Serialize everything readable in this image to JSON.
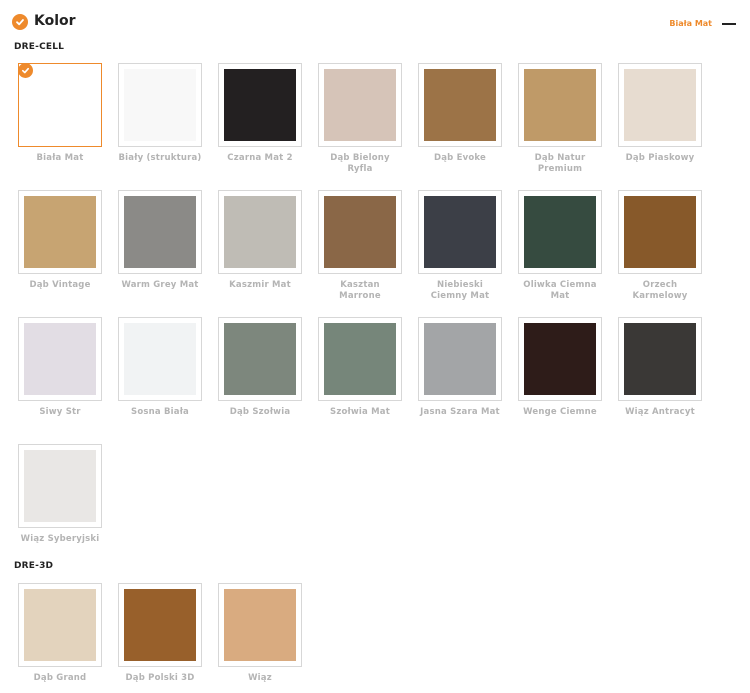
{
  "header": {
    "title": "Kolor",
    "selected_value": "Biała Mat"
  },
  "sections": [
    {
      "title": "DRE-CELL",
      "swatches": [
        {
          "label": "Biała Mat",
          "color": "#ffffff",
          "selected": true
        },
        {
          "label": "Biały (struktura)",
          "color": "#f8f8f8"
        },
        {
          "label": "Czarna Mat 2",
          "color": "#232021"
        },
        {
          "label": "Dąb Bielony Ryfla",
          "color": "#d6c4b8"
        },
        {
          "label": "Dąb Evoke",
          "color": "#9c7347"
        },
        {
          "label": "Dąb Natur Premium",
          "color": "#bf9a68"
        },
        {
          "label": "Dąb Piaskowy",
          "color": "#e7dcd0"
        },
        {
          "label": "Dąb Vintage",
          "color": "#c7a472"
        },
        {
          "label": "Warm Grey Mat",
          "color": "#8b8a87"
        },
        {
          "label": "Kaszmir Mat",
          "color": "#bfbcb5"
        },
        {
          "label": "Kasztan Marrone",
          "color": "#8a6747"
        },
        {
          "label": "Niebieski Ciemny Mat",
          "color": "#3c3f47"
        },
        {
          "label": "Oliwka Ciemna Mat",
          "color": "#364b40"
        },
        {
          "label": "Orzech Karmelowy",
          "color": "#87592a"
        },
        {
          "label": "Siwy Str",
          "color": "#e2dde4"
        },
        {
          "label": "Sosna Biała",
          "color": "#f1f3f4"
        },
        {
          "label": "Dąb Szołwia",
          "color": "#7d877d"
        },
        {
          "label": "Szołwia Mat",
          "color": "#76867a"
        },
        {
          "label": "Jasna Szara Mat",
          "color": "#a3a5a7"
        },
        {
          "label": "Wenge Ciemne",
          "color": "#2e1c19"
        },
        {
          "label": "Wiąz Antracyt",
          "color": "#3a3836"
        },
        {
          "label": "Wiąz Syberyjski",
          "color": "#e9e7e5"
        }
      ]
    },
    {
      "title": "DRE-3D",
      "swatches": [
        {
          "label": "Dąb Grand",
          "color": "#e3d3bd"
        },
        {
          "label": "Dąb Polski 3D",
          "color": "#98602b"
        },
        {
          "label": "Wiąz",
          "color": "#d9ab80"
        }
      ]
    }
  ]
}
